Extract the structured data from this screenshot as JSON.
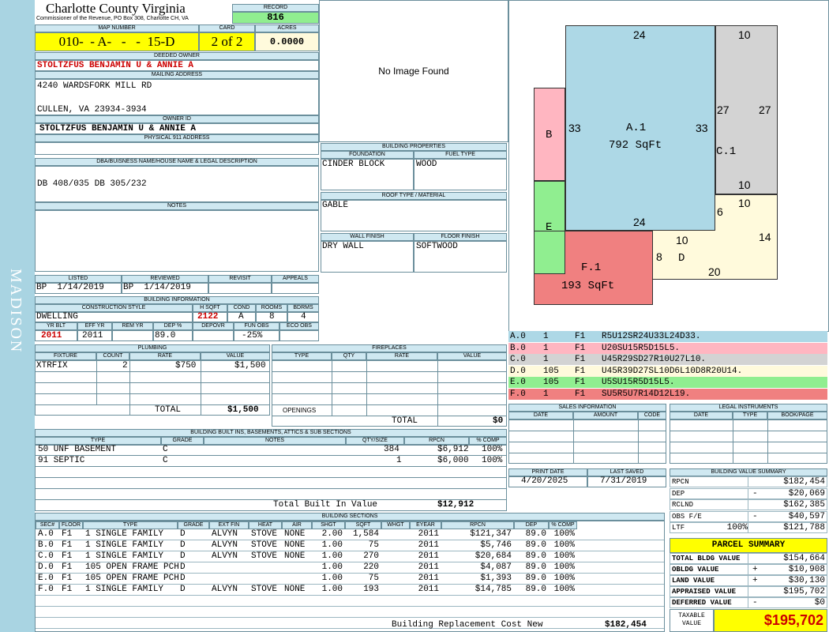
{
  "county": {
    "name": "Charlotte County Virginia",
    "address": "Commissioner of the Revenue, PO Box 308, Charlotte CH, VA"
  },
  "sidebar_text": "MADISON",
  "record": {
    "label": "RECORD",
    "value": "816"
  },
  "map_number": {
    "label": "MAP NUMBER",
    "value": "010-  - A-   -   -  15-D"
  },
  "card": {
    "label": "CARD",
    "value": "2 of 2"
  },
  "acres": {
    "label": "ACRES",
    "value": "0.0000"
  },
  "deeded_owner": {
    "label": "DEEDED OWNER",
    "value": "STOLTZFUS BENJAMIN U & ANNIE A"
  },
  "mailing": {
    "label": "MAILING ADDRESS",
    "line1": "4240 WARDSFORK MILL RD",
    "line2": "CULLEN, VA 23934-3934"
  },
  "owner_id": {
    "label": "OWNER ID",
    "value": "STOLTZFUS BENJAMIN U & ANNIE A"
  },
  "physical_address": {
    "label": "PHYSICAL 911 ADDRESS",
    "value": ""
  },
  "dba": {
    "label": "DBA/BUISNESS NAME/HOUSE NAME & LEGAL DESCRIPTION",
    "value": "DB 408/035 DB 305/232"
  },
  "notes": {
    "label": "NOTES"
  },
  "image": {
    "text": "No Image Found"
  },
  "building_props": {
    "label": "BUILDING PROPERTIES",
    "foundation_label": "FOUNDATION",
    "fueltype_label": "FUEL TYPE",
    "foundation": "CINDER BLOCK",
    "fueltype": "WOOD",
    "roof_label": "ROOF TYPE / MATERIAL",
    "roof": "GABLE",
    "wall_label": "WALL FINISH",
    "floor_label": "FLOOR FINISH",
    "wall": "DRY WALL",
    "floor": "SOFTWOOD"
  },
  "dates": {
    "listed_label": "LISTED",
    "reviewed_label": "REVIEWED",
    "revisit_label": "REVISIT",
    "appeals_label": "APPEALS",
    "listed": "BP  1/14/2019",
    "reviewed": "BP  1/14/2019"
  },
  "building_info": {
    "label": "BUILDING INFORMATION",
    "cs_label": "CONSTRUCTION STYLE",
    "hsqft_label": "H SQFT",
    "cond_label": "COND",
    "rooms_label": "ROOMS",
    "bdrms_label": "BDRMS",
    "cs": "DWELLING",
    "hsqft": "2122",
    "cond": "A",
    "rooms": "8",
    "bdrms": "4",
    "yrblt_label": "YR BLT",
    "effyr_label": "EFF YR",
    "remyr_label": "REM YR",
    "dep_label": "DEP %",
    "depovr_label": "DEPOVR",
    "funobs_label": "FUN OBS",
    "ecoobs_label": "ECO OBS",
    "yrblt": "2011",
    "effyr": "2011",
    "dep": "89.0",
    "funobs": "-25%"
  },
  "plumbing": {
    "label": "PLUMBING",
    "headers": [
      "FIXTURE",
      "COUNT",
      "RATE",
      "VALUE"
    ],
    "rows": [
      [
        "XTRFIX",
        "2",
        "$750",
        "$1,500"
      ]
    ],
    "total_label": "TOTAL",
    "total": "$1,500"
  },
  "fireplaces": {
    "label": "FIREPLACES",
    "headers": [
      "TYPE",
      "QTY",
      "RATE",
      "VALUE"
    ],
    "openings_label": "OPENINGS",
    "total_label": "TOTAL",
    "total": "$0"
  },
  "built_ins": {
    "label": "BUILDING BUILT INS, BASEMENTS, ATTICS & SUB SECTIONS",
    "headers": [
      "TYPE",
      "GRADE",
      "NOTES",
      "QTY/SIZE",
      "RPCN",
      "% COMP"
    ],
    "rows": [
      [
        "50 UNF BASEMENT",
        "C",
        "",
        "384",
        "$6,912",
        "100%"
      ],
      [
        "91 SEPTIC",
        "C",
        "",
        "1",
        "$6,000",
        "100%"
      ]
    ],
    "total_label": "Total Built In Value",
    "total": "$12,912"
  },
  "sections": {
    "label": "BUILDING SECTIONS",
    "headers": [
      "SEC#",
      "FLOOR",
      "TYPE",
      "GRADE",
      "EXT FIN",
      "HEAT",
      "AIR",
      "SHGT",
      "SQFT",
      "WHGT",
      "EYEAR",
      "RPCN",
      "DEP",
      "% COMP"
    ],
    "rows": [
      [
        "A.0",
        "F1",
        "1 SINGLE FAMILY",
        "D",
        "ALVYN",
        "STOVE",
        "NONE",
        "2.00",
        "1,584",
        "",
        "2011",
        "$121,347",
        "89.0",
        "100%"
      ],
      [
        "B.0",
        "F1",
        "1 SINGLE FAMILY",
        "D",
        "ALVYN",
        "STOVE",
        "NONE",
        "1.00",
        "75",
        "",
        "2011",
        "$5,746",
        "89.0",
        "100%"
      ],
      [
        "C.0",
        "F1",
        "1 SINGLE FAMILY",
        "D",
        "ALVYN",
        "STOVE",
        "NONE",
        "1.00",
        "270",
        "",
        "2011",
        "$20,684",
        "89.0",
        "100%"
      ],
      [
        "D.0",
        "F1",
        "105 OPEN FRAME PCH",
        "D",
        "",
        "",
        "",
        "1.00",
        "220",
        "",
        "2011",
        "$4,087",
        "89.0",
        "100%"
      ],
      [
        "E.0",
        "F1",
        "105 OPEN FRAME PCH",
        "D",
        "",
        "",
        "",
        "1.00",
        "75",
        "",
        "2011",
        "$1,393",
        "89.0",
        "100%"
      ],
      [
        "F.0",
        "F1",
        "1 SINGLE FAMILY",
        "D",
        "ALVYN",
        "STOVE",
        "NONE",
        "1.00",
        "193",
        "",
        "2011",
        "$14,785",
        "89.0",
        "100%"
      ]
    ],
    "total_label": "Building Replacement Cost New",
    "total": "$182,454"
  },
  "sketch": {
    "a_label": "A.1",
    "a_area": "792 SqFt",
    "c_label": "C.1",
    "f_label": "F.1",
    "f_area": "193 SqFt",
    "b_label": "B",
    "e_label": "E",
    "d_label": "D",
    "dims": {
      "a_top": "24",
      "a_left": "33",
      "a_right": "33",
      "a_bottom": "24",
      "c_top": "10",
      "c_left": "27",
      "c_right": "27",
      "c_bottom": "10",
      "d_top": "10",
      "d_left": "6",
      "d_right": "14",
      "d_bottom": "20",
      "d_mid": "10",
      "f_right": "8"
    },
    "colors": {
      "A": "#add8e6",
      "B": "#ffb6c1",
      "C": "#d3d3d3",
      "D": "#fffadc",
      "E": "#90ee90",
      "F": "#f08080"
    }
  },
  "sketch_legend": [
    {
      "sec": "A.0",
      "n": "1",
      "fl": "F1",
      "code": "R5U12SR24U33L24D33.",
      "color": "#add8e6"
    },
    {
      "sec": "B.0",
      "n": "1",
      "fl": "F1",
      "code": "U20SU15R5D15L5.",
      "color": "#ffb6c1"
    },
    {
      "sec": "C.0",
      "n": "1",
      "fl": "F1",
      "code": "U45R29SD27R10U27L10.",
      "color": "#d3d3d3"
    },
    {
      "sec": "D.0",
      "n": "105",
      "fl": "F1",
      "code": "U45R39D27SL10D6L10D8R20U14.",
      "color": "#fffadc"
    },
    {
      "sec": "E.0",
      "n": "105",
      "fl": "F1",
      "code": "U5SU15R5D15L5.",
      "color": "#90ee90"
    },
    {
      "sec": "F.0",
      "n": "1",
      "fl": "F1",
      "code": "SU5R5U7R14D12L19.",
      "color": "#f08080"
    }
  ],
  "sales": {
    "label": "SALES INFORMATION",
    "headers": [
      "DATE",
      "AMOUNT",
      "CODE"
    ]
  },
  "legal": {
    "label": "LEGAL INSTRUMENTS",
    "headers": [
      "DATE",
      "TYPE",
      "BOOK/PAGE"
    ]
  },
  "print": {
    "print_label": "PRINT DATE",
    "saved_label": "LAST SAVED",
    "print_date": "4/20/2025",
    "last_saved": "7/31/2019"
  },
  "value_summary": {
    "label": "BUILDING VALUE SUMMARY",
    "rows": [
      {
        "name": "RPCN",
        "sign": "",
        "pct": "",
        "value": "$182,454"
      },
      {
        "name": "DEP",
        "sign": "-",
        "pct": "",
        "value": "$20,069"
      },
      {
        "name": "RCLND",
        "sign": "",
        "pct": "",
        "value": "$162,385"
      },
      {
        "name": "OBS F/E",
        "sign": "-",
        "pct": "",
        "value": "$40,597"
      },
      {
        "name": "LTF",
        "sign": "",
        "pct": "100%",
        "value": "$121,788"
      }
    ]
  },
  "parcel": {
    "label": "PARCEL SUMMARY",
    "rows": [
      {
        "name": "TOTAL BLDG VALUE",
        "sign": "",
        "value": "$154,664"
      },
      {
        "name": "OBLDG VALUE",
        "sign": "+",
        "value": "$10,908"
      },
      {
        "name": "LAND VALUE",
        "sign": "+",
        "value": "$30,130"
      },
      {
        "name": "APPRAISED VALUE",
        "sign": "",
        "value": "$195,702"
      },
      {
        "name": "DEFERRED VALUE",
        "sign": "-",
        "value": "$0"
      }
    ],
    "taxable_label": "TAXABLE VALUE",
    "taxable": "$195,702"
  }
}
